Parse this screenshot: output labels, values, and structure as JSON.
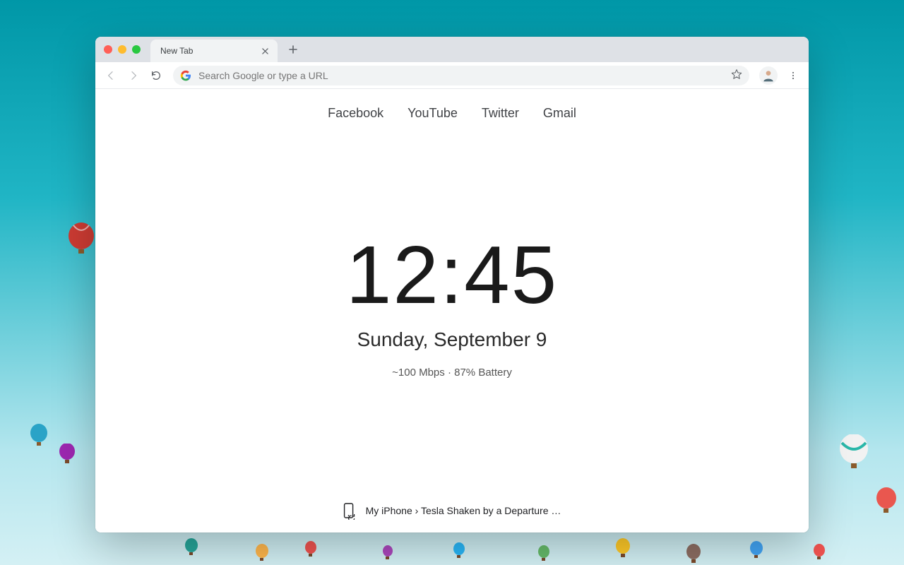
{
  "tab": {
    "title": "New Tab"
  },
  "omnibox": {
    "placeholder": "Search Google or type a URL"
  },
  "quick_links": [
    "Facebook",
    "YouTube",
    "Twitter",
    "Gmail"
  ],
  "clock": {
    "time": "12:45",
    "date": "Sunday, September 9"
  },
  "status": {
    "speed": "~100 Mbps",
    "separator": " · ",
    "battery": "87% Battery"
  },
  "handoff": {
    "device": "My iPhone",
    "sep": " › ",
    "title": "Tesla Shaken by a Departure …"
  }
}
